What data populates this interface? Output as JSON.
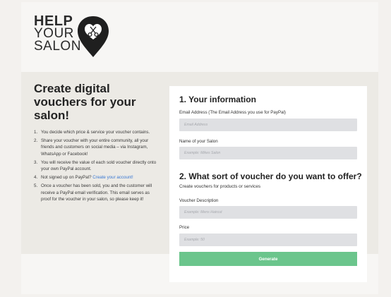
{
  "logo": {
    "line1": "HELP",
    "line2": "YOUR",
    "line3": "SALON",
    "icon": "scissors-heart-pin-icon"
  },
  "intro": {
    "title": "Create digital vouchers for your salon!",
    "steps": [
      {
        "num": "1.",
        "text": "You decide which price & service your voucher contains."
      },
      {
        "num": "2.",
        "text": "Share your voucher with your entire community, all your friends and customers on social media – via Instagram, WhatsApp or Facebook!"
      },
      {
        "num": "3.",
        "text": "You will receive the value of each sold voucher directly onto your own PayPal account."
      },
      {
        "num": "4.",
        "text": "Not signed up on PayPal?",
        "link": "Create your account!"
      },
      {
        "num": "5.",
        "text": "Once a voucher has been sold, you and the customer will receive a PayPal email verification. This email serves as proof for the voucher in your salon, so please keep it!"
      }
    ]
  },
  "form": {
    "section1_title": "1. Your information",
    "email_label": "Email Address (The Email Address you use for PayPal)",
    "email_placeholder": "Email Address",
    "salon_label": "Name of your Salon",
    "salon_placeholder": "Example: Mikes Salon",
    "section2_title": "2. What sort of voucher do you want to offer?",
    "section2_sub": "Create vouchers for products or services",
    "desc_label": "Voucher Description",
    "desc_placeholder": "Example: Mens Haircut",
    "price_label": "Price",
    "price_placeholder": "Example: 50",
    "generate_label": "Generate"
  },
  "colors": {
    "accent_green": "#6bc58c",
    "link_blue": "#3a78d3",
    "field_bg": "#dfe0e3"
  }
}
